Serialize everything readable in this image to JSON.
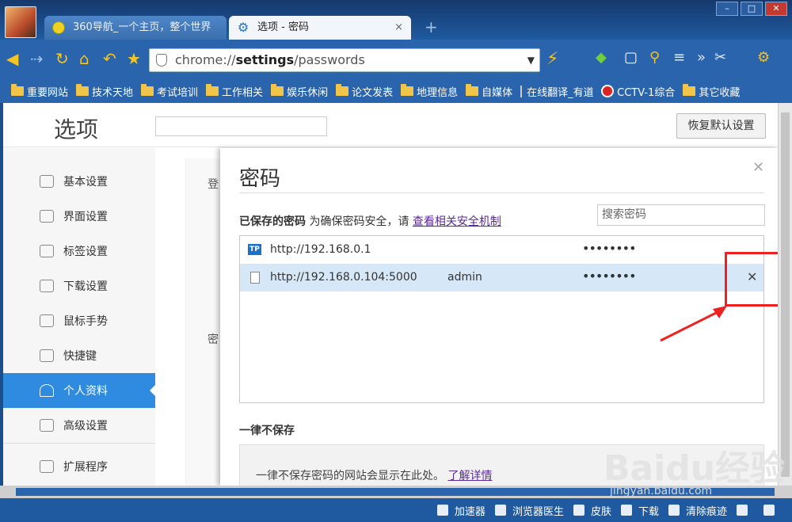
{
  "tabs": [
    {
      "label": "360导航_一个主页，整个世界"
    },
    {
      "label": "选项 - 密码"
    }
  ],
  "url": {
    "prefix": "chrome://",
    "bold": "settings",
    "suffix": "/passwords"
  },
  "bookmarks": [
    "重要网站",
    "技术天地",
    "考试培训",
    "工作相关",
    "娱乐休闲",
    "论文发表",
    "地理信息",
    "自媒体",
    "在线翻译_有道",
    "CCTV-1综合",
    "其它收藏"
  ],
  "options": {
    "title": "选项",
    "restore_label": "恢复默认设置"
  },
  "sidebar": {
    "items": [
      "基本设置",
      "界面设置",
      "标签设置",
      "下载设置",
      "鼠标手势",
      "快捷键",
      "个人资料",
      "高级设置",
      "扩展程序"
    ]
  },
  "bg": {
    "label1": "登",
    "label2": "密"
  },
  "dialog": {
    "title": "密码",
    "saved_bold": "已保存的密码",
    "saved_text": " 为确保密码安全，请 ",
    "saved_link": "查看相关安全机制",
    "search_placeholder": "搜索密码",
    "passwords": [
      {
        "url": "http://192.168.0.1",
        "user": "",
        "pw": "••••••••"
      },
      {
        "url": "http://192.168.0.104:5000",
        "user": "admin",
        "pw": "••••••••"
      }
    ],
    "never_title": "一律不保存",
    "never_text": "一律不保存密码的网站会显示在此处。",
    "never_link": "了解详情"
  },
  "status": [
    "加速器",
    "浏览器医生",
    "皮肤",
    "下载",
    "清除痕迹"
  ],
  "watermark": {
    "main": "Baidu经验",
    "sub": "jingyan.baidu.com"
  },
  "colors": {
    "accent": "#2f8be0",
    "highlight": "#ee2020"
  }
}
